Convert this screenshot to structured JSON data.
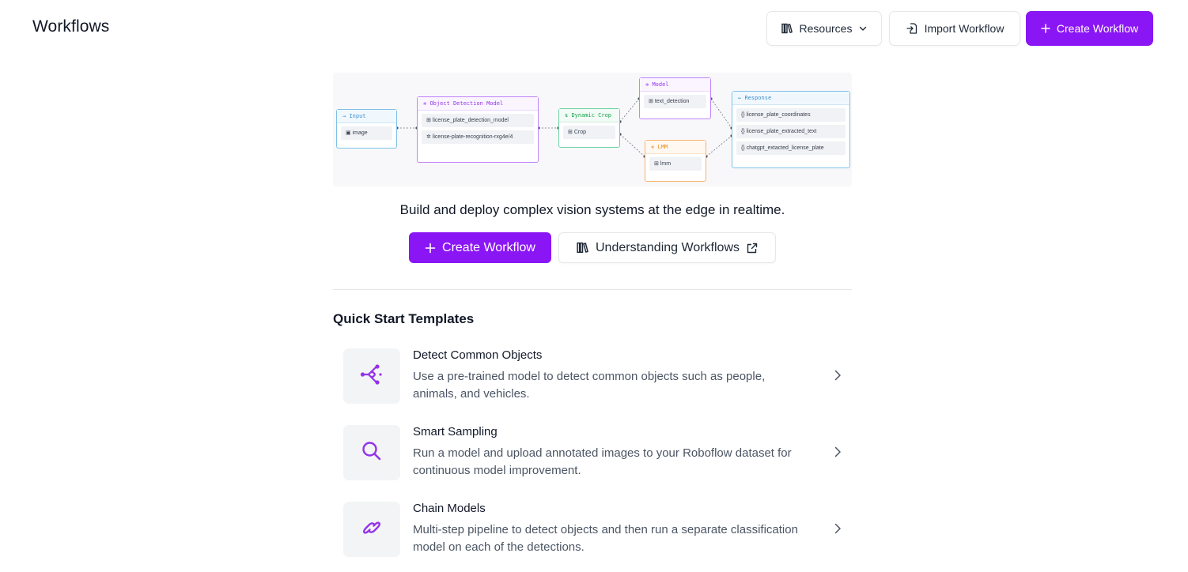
{
  "header": {
    "title": "Workflows",
    "resources_label": "Resources",
    "import_label": "Import Workflow",
    "create_label": "Create Workflow"
  },
  "diagram": {
    "input": {
      "title": "Input",
      "items": [
        "image"
      ]
    },
    "object_detection": {
      "title": "Object Detection Model",
      "items": [
        "license_plate_detection_model",
        "license-plate-recognition-rxg4e/4"
      ]
    },
    "dynamic_crop": {
      "title": "Dynamic Crop",
      "items": [
        "Crop"
      ]
    },
    "model": {
      "title": "Model",
      "items": [
        "text_detection"
      ]
    },
    "lmm": {
      "title": "LMM",
      "items": [
        "lmm"
      ]
    },
    "response": {
      "title": "Response",
      "items": [
        "license_plate_coordinates",
        "license_plate_extracted_text",
        "chatgpt_extacted_license_plate"
      ]
    }
  },
  "hero": {
    "tagline": "Build and deploy complex vision systems at the edge in realtime.",
    "create_label": "Create Workflow",
    "understanding_label": "Understanding Workflows"
  },
  "templates": {
    "title": "Quick Start Templates",
    "items": [
      {
        "title": "Detect Common Objects",
        "description": "Use a pre-trained model to detect common objects such as people, animals, and vehicles.",
        "icon": "graph-nodes-icon"
      },
      {
        "title": "Smart Sampling",
        "description": "Run a model and upload annotated images to your Roboflow dataset for continuous model improvement.",
        "icon": "search-icon"
      },
      {
        "title": "Chain Models",
        "description": "Multi-step pipeline to detect objects and then run a separate classification model on each of the detections.",
        "icon": "link-icon"
      }
    ]
  },
  "colors": {
    "primary": "#8b16f5",
    "icon_accent": "#9333ea"
  }
}
